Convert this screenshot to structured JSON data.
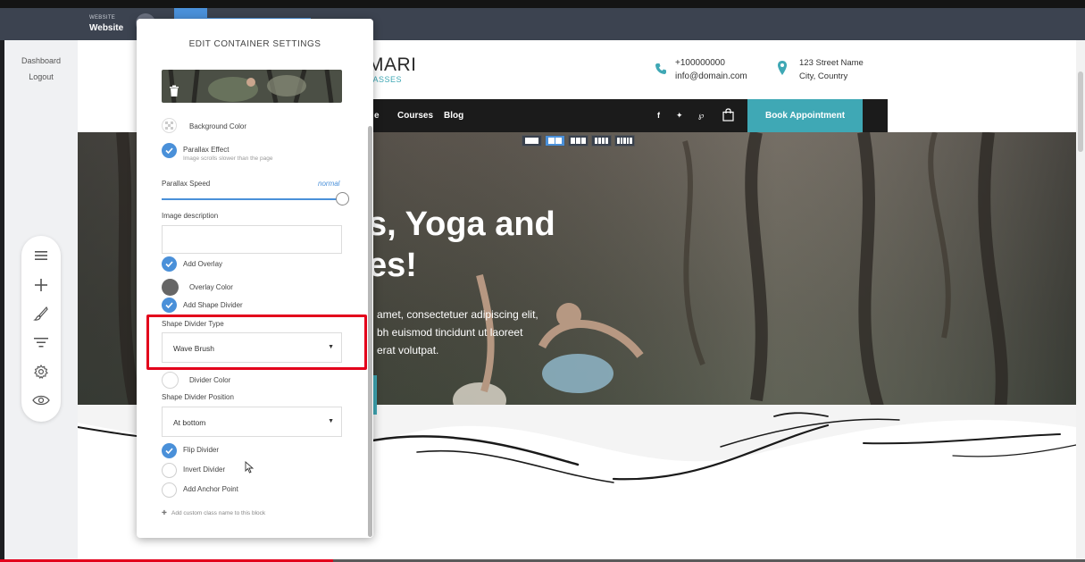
{
  "topbar": {
    "site_small": "WEBSITE",
    "site_label": "Website"
  },
  "sidebar": {
    "dashboard": "Dashboard",
    "logout": "Logout",
    "tools": [
      "menu-icon",
      "plus-icon",
      "brush-icon",
      "filter-icon",
      "gear-icon",
      "eye-icon"
    ]
  },
  "site": {
    "brand": "MARI",
    "brand_sub": "LASSES",
    "phone": "+100000000",
    "email": "info@domain.com",
    "address1": "123 Street Name",
    "address2": "City, Country",
    "nav": [
      "e",
      "Courses",
      "Blog"
    ],
    "social": [
      "f",
      "✦",
      "℘"
    ],
    "book_label": "Book Appointment",
    "hero_title": ", Yoga and es!",
    "hero_title_l1": "s, Yoga and",
    "hero_title_l2": "es!",
    "hero_text_l1": "amet, consectetuer adipiscing elit,",
    "hero_text_l2": "bh euismod tincidunt ut laoreet",
    "hero_text_l3": "erat volutpat."
  },
  "panel": {
    "title": "EDIT CONTAINER SETTINGS",
    "background_color": "Background Color",
    "parallax_effect": "Parallax Effect",
    "parallax_sub": "Image scrolls slower than the page",
    "parallax_speed": "Parallax Speed",
    "parallax_speed_value": "normal",
    "image_description": "Image description",
    "add_overlay": "Add Overlay",
    "overlay_color": "Overlay Color",
    "add_shape_divider": "Add Shape Divider",
    "shape_divider_type": "Shape Divider Type",
    "shape_divider_type_value": "Wave Brush",
    "divider_color": "Divider Color",
    "shape_divider_position": "Shape Divider Position",
    "shape_divider_position_value": "At bottom",
    "flip_divider": "Flip Divider",
    "invert_divider": "Invert Divider",
    "add_anchor": "Add Anchor Point",
    "custom_class": "Add custom class name to this block",
    "parallax_speed_fraction": 1.0
  },
  "colors": {
    "accent": "#4a90d9",
    "teal": "#3fa8b5",
    "highlight": "#e3001b"
  },
  "video_progress_fraction": 0.307
}
